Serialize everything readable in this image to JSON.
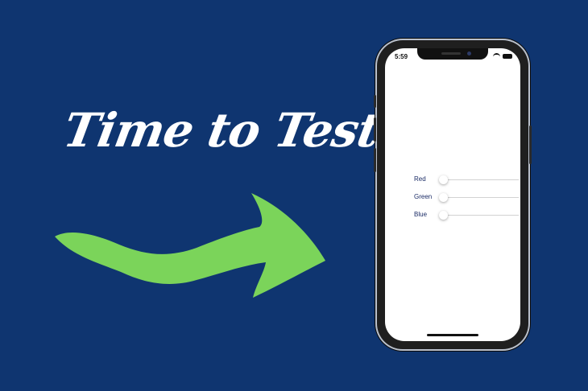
{
  "headline": "Time to Test",
  "phone": {
    "status_time": "5:59",
    "sliders": [
      {
        "label": "Red",
        "value": 0
      },
      {
        "label": "Green",
        "value": 0
      },
      {
        "label": "Blue",
        "value": 0
      }
    ]
  },
  "colors": {
    "background": "#0f3570",
    "arrow": "#7bd45a",
    "headline": "#ffffff"
  }
}
